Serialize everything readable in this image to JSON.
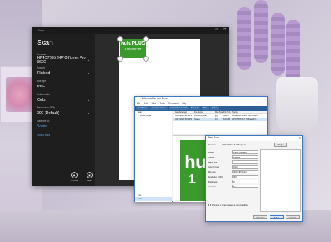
{
  "scan_app": {
    "title": "Scan",
    "window_controls": [
      "–",
      "□",
      "✕"
    ],
    "heading": "Scan",
    "fields": [
      {
        "label": "Scanner",
        "value": "HP4C7695 (HP Officejet Pro 862C"
      },
      {
        "label": "Source",
        "value": "Flatbed"
      },
      {
        "label": "File type",
        "value": "PDF"
      },
      {
        "label": "Color mode",
        "value": "Color"
      },
      {
        "label": "Resolution (DPI)",
        "value": "300 (Default)"
      },
      {
        "label": "Save file to",
        "value": "Scans"
      }
    ],
    "show_less": "Show less",
    "preview_label": "Preview",
    "scan_label": "Scan",
    "card": {
      "title": "huluPLUS",
      "subtitle": "1 Month Free"
    }
  },
  "fax_scan": {
    "title": "Windows Fax and Scan",
    "menu": [
      "File",
      "Edit",
      "View",
      "Tools",
      "Document",
      "Help"
    ],
    "toolbar": [
      "New Scan",
      "Forward as Fax",
      "Forward as E-mail",
      "Save as",
      "Print",
      "Delete"
    ],
    "tree": [
      "Scan",
      "Documents"
    ],
    "tree_bottom": [
      "Fax",
      "Scan"
    ],
    "columns": [
      "Date Scanned",
      "File Name",
      "File Type",
      "File Size",
      "Source"
    ],
    "rows": [
      [
        "10/12/2020 8:21 PM",
        "Welcome Scan",
        "jpg",
        "93 KB",
        "Windows Fax and Scan Team"
      ],
      [
        "10/17/2020 8:21 PM",
        "Image",
        "jpg",
        "169 KB",
        "HP4C7695 (HP Officejet Pro"
      ]
    ],
    "preview": {
      "big_h": "hu",
      "big_1": "1"
    }
  },
  "new_scan": {
    "title": "New Scan",
    "scanner_label": "Scanner:",
    "scanner_value": "HP4C7695 (HP Officejet Pr...",
    "change_button": "Change...",
    "fields": [
      {
        "label": "Profile:",
        "value": "Photo (Default)"
      },
      {
        "label": "Source:",
        "value": "Flatbed"
      },
      {
        "label": "Paper size:",
        "value": ""
      },
      {
        "label": "Color format:",
        "value": "Color"
      },
      {
        "label": "File type:",
        "value": "JPG (JPG File)"
      },
      {
        "label": "Resolution (DPI):",
        "value": "300"
      },
      {
        "label": "Brightness:",
        "value": "0"
      },
      {
        "label": "Contrast:",
        "value": "0"
      }
    ],
    "checkbox_label": "Preview or scan images as separate files",
    "buttons": [
      "Preview",
      "Scan",
      "Cancel"
    ]
  }
}
